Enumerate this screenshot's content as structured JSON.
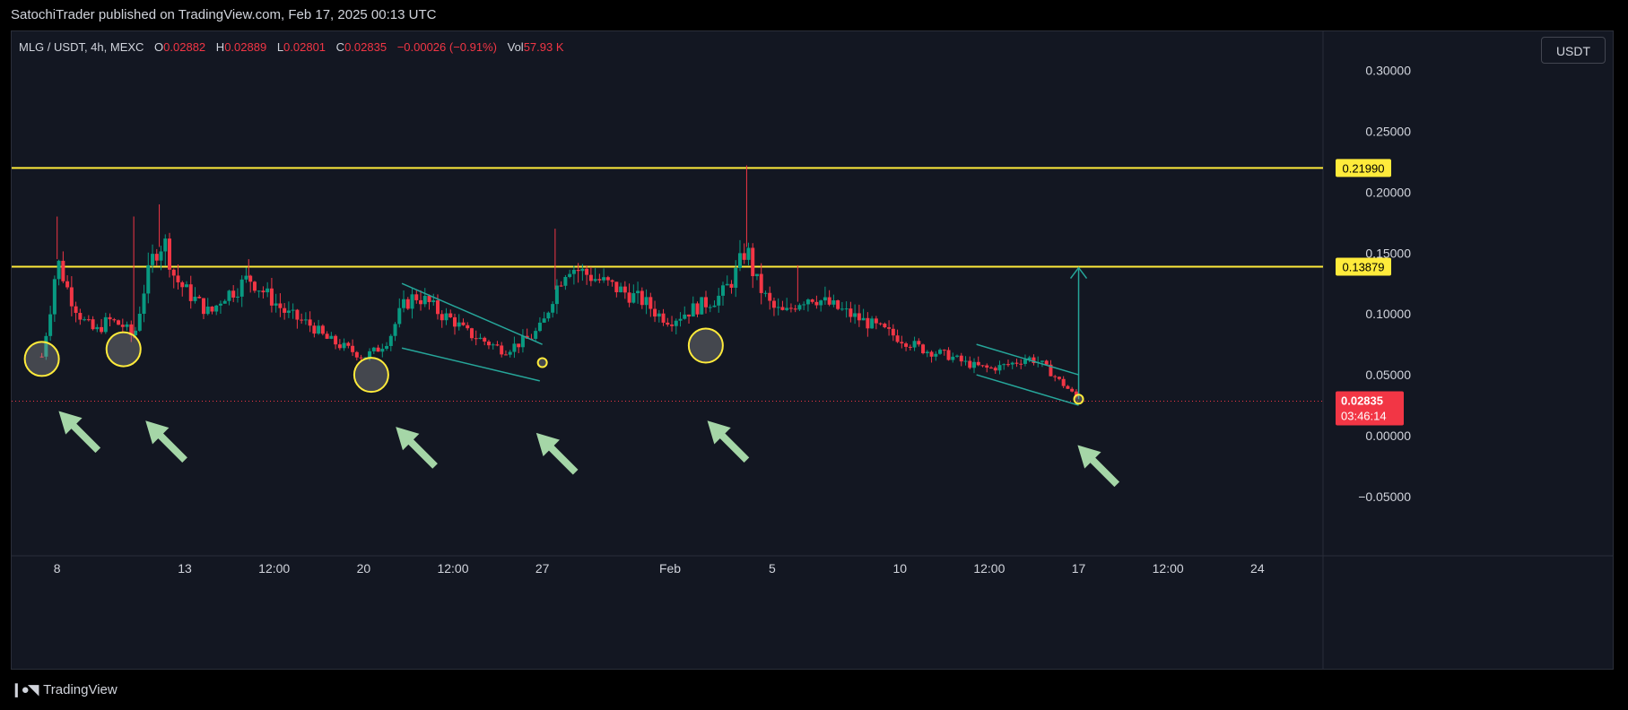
{
  "header": {
    "published_text": "SatochiTrader published on TradingView.com, Feb 17, 2025 00:13 UTC"
  },
  "legend": {
    "symbol": "MLG / USDT, 4h, MEXC",
    "o_label": "O",
    "o_value": "0.02882",
    "h_label": "H",
    "h_value": "0.02889",
    "l_label": "L",
    "l_value": "0.02801",
    "c_label": "C",
    "c_value": "0.02835",
    "change": "−0.00026 (−0.91%)",
    "vol_label": "Vol",
    "vol_value": "57.93 K"
  },
  "toolbar": {
    "currency_label": "USDT"
  },
  "brand": {
    "name": "TradingView",
    "logo_icon": "tradingview-logo-icon"
  },
  "colors": {
    "up": "#089981",
    "down": "#f23645",
    "level": "#ffeb3b",
    "annotation": "#a5d6a7",
    "channel": "#26a69a",
    "background": "#131722"
  },
  "chart_data": {
    "type": "candlestick",
    "symbol": "MLG / USDT",
    "interval": "4h",
    "exchange": "MEXC",
    "ylim": [
      -0.095,
      0.31
    ],
    "y_ticks": [
      "0.30000",
      "0.25000",
      "0.20000",
      "0.15000",
      "0.10000",
      "0.05000",
      "0.00000",
      "−0.05000"
    ],
    "y_tick_values": [
      0.3,
      0.25,
      0.2,
      0.15,
      0.1,
      0.05,
      0.0,
      -0.05
    ],
    "x_ticks": [
      {
        "label": "8",
        "t": 0.0
      },
      {
        "label": "13",
        "t": 5.0
      },
      {
        "label": "12:00",
        "t": 8.5
      },
      {
        "label": "20",
        "t": 12.0
      },
      {
        "label": "12:00",
        "t": 15.5
      },
      {
        "label": "27",
        "t": 19.0
      },
      {
        "label": "Feb",
        "t": 24.0
      },
      {
        "label": "5",
        "t": 28.0
      },
      {
        "label": "10",
        "t": 33.0
      },
      {
        "label": "12:00",
        "t": 36.5
      },
      {
        "label": "17",
        "t": 40.0
      },
      {
        "label": "12:00",
        "t": 43.5
      },
      {
        "label": "24",
        "t": 47.0
      }
    ],
    "price_levels": [
      {
        "label": "0.21990",
        "value": 0.2199
      },
      {
        "label": "0.13879",
        "value": 0.13879
      }
    ],
    "last_price": {
      "label": "0.02835",
      "value": 0.02835,
      "countdown": "03:46:14"
    },
    "price_path": [
      [
        -0.6,
        0.065
      ],
      [
        -0.3,
        0.1
      ],
      [
        0.0,
        0.145
      ],
      [
        0.5,
        0.115
      ],
      [
        1.0,
        0.095
      ],
      [
        1.5,
        0.085
      ],
      [
        2.0,
        0.095
      ],
      [
        2.6,
        0.09
      ],
      [
        3.0,
        0.08
      ],
      [
        3.4,
        0.12
      ],
      [
        3.8,
        0.15
      ],
      [
        4.2,
        0.16
      ],
      [
        4.6,
        0.13
      ],
      [
        5.0,
        0.12
      ],
      [
        5.5,
        0.11
      ],
      [
        6.0,
        0.1
      ],
      [
        6.5,
        0.115
      ],
      [
        7.0,
        0.12
      ],
      [
        7.5,
        0.13
      ],
      [
        8.0,
        0.12
      ],
      [
        8.5,
        0.11
      ],
      [
        9.0,
        0.1
      ],
      [
        9.5,
        0.095
      ],
      [
        10.0,
        0.09
      ],
      [
        10.5,
        0.08
      ],
      [
        11.0,
        0.075
      ],
      [
        11.5,
        0.07
      ],
      [
        12.0,
        0.065
      ],
      [
        12.5,
        0.07
      ],
      [
        13.0,
        0.08
      ],
      [
        13.5,
        0.105
      ],
      [
        14.0,
        0.115
      ],
      [
        14.5,
        0.11
      ],
      [
        15.0,
        0.1
      ],
      [
        15.5,
        0.095
      ],
      [
        16.0,
        0.085
      ],
      [
        16.5,
        0.08
      ],
      [
        17.0,
        0.075
      ],
      [
        17.5,
        0.07
      ],
      [
        18.0,
        0.075
      ],
      [
        18.5,
        0.08
      ],
      [
        19.0,
        0.09
      ],
      [
        19.5,
        0.12
      ],
      [
        20.0,
        0.14
      ],
      [
        20.5,
        0.135
      ],
      [
        21.0,
        0.13
      ],
      [
        21.5,
        0.125
      ],
      [
        22.0,
        0.12
      ],
      [
        22.5,
        0.115
      ],
      [
        23.0,
        0.11
      ],
      [
        23.5,
        0.1
      ],
      [
        24.0,
        0.095
      ],
      [
        24.5,
        0.1
      ],
      [
        25.0,
        0.105
      ],
      [
        25.5,
        0.11
      ],
      [
        26.0,
        0.115
      ],
      [
        26.5,
        0.13
      ],
      [
        27.0,
        0.155
      ],
      [
        27.3,
        0.13
      ],
      [
        27.7,
        0.115
      ],
      [
        28.0,
        0.105
      ],
      [
        28.5,
        0.1
      ],
      [
        29.0,
        0.11
      ],
      [
        29.5,
        0.115
      ],
      [
        30.0,
        0.11
      ],
      [
        30.5,
        0.105
      ],
      [
        31.0,
        0.1
      ],
      [
        31.5,
        0.095
      ],
      [
        32.0,
        0.09
      ],
      [
        32.5,
        0.085
      ],
      [
        33.0,
        0.08
      ],
      [
        33.5,
        0.075
      ],
      [
        34.0,
        0.07
      ],
      [
        34.5,
        0.068
      ],
      [
        35.0,
        0.065
      ],
      [
        35.5,
        0.06
      ],
      [
        36.0,
        0.057
      ],
      [
        36.5,
        0.055
      ],
      [
        37.0,
        0.057
      ],
      [
        37.5,
        0.06
      ],
      [
        38.0,
        0.064
      ],
      [
        38.5,
        0.06
      ],
      [
        39.0,
        0.05
      ],
      [
        39.5,
        0.04
      ],
      [
        40.0,
        0.03
      ]
    ],
    "wicks": [
      {
        "t": 0.0,
        "high": 0.18
      },
      {
        "t": 3.0,
        "high": 0.18
      },
      {
        "t": 4.0,
        "high": 0.19
      },
      {
        "t": 7.5,
        "high": 0.145
      },
      {
        "t": 19.5,
        "high": 0.17
      },
      {
        "t": 27.0,
        "high": 0.222
      },
      {
        "t": 29.0,
        "high": 0.14
      }
    ],
    "channels": [
      {
        "upper": [
          [
            13.5,
            0.125
          ],
          [
            19.0,
            0.075
          ]
        ],
        "lower": [
          [
            13.5,
            0.072
          ],
          [
            18.9,
            0.045
          ]
        ]
      },
      {
        "upper": [
          [
            36.0,
            0.075
          ],
          [
            40.0,
            0.05
          ]
        ],
        "lower": [
          [
            36.0,
            0.05
          ],
          [
            40.0,
            0.025
          ]
        ]
      }
    ],
    "target_arrow": {
      "t": 40.0,
      "from": 0.03,
      "to": 0.138
    },
    "circles": [
      {
        "t": -0.6,
        "y": 0.063,
        "size": "large"
      },
      {
        "t": 2.6,
        "y": 0.071,
        "size": "large"
      },
      {
        "t": 12.3,
        "y": 0.05,
        "size": "large"
      },
      {
        "t": 19.0,
        "y": 0.06,
        "size": "small"
      },
      {
        "t": 25.4,
        "y": 0.074,
        "size": "large"
      },
      {
        "t": 40.0,
        "y": 0.03,
        "size": "small"
      }
    ],
    "arrows": [
      {
        "t": 1.6,
        "y": -0.012
      },
      {
        "t": 5.0,
        "y": -0.02
      },
      {
        "t": 14.8,
        "y": -0.025
      },
      {
        "t": 20.3,
        "y": -0.03
      },
      {
        "t": 27.0,
        "y": -0.02
      },
      {
        "t": 41.5,
        "y": -0.04
      }
    ]
  }
}
